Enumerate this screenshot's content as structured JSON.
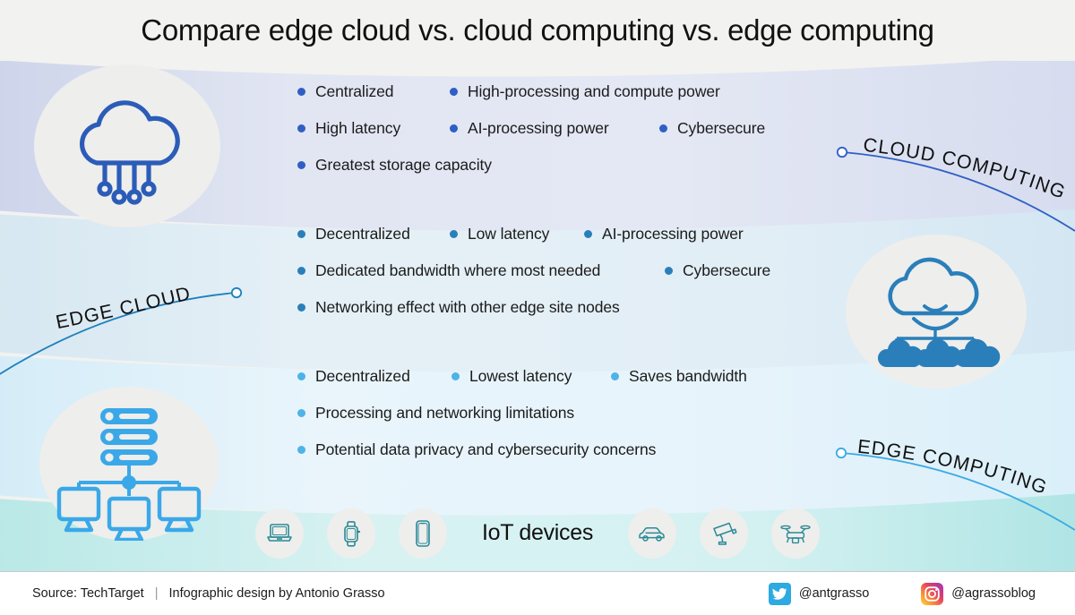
{
  "title": "Compare edge cloud vs. cloud computing vs. edge computing",
  "colors": {
    "cloud_band": "#dfe3f0",
    "edge_cloud_band": "#ddeaf2",
    "edge_computing_band": "#e2f0f8",
    "iot_band": "#cceeee",
    "cloud_bullet": "#2f5fc4",
    "edge_cloud_bullet": "#2a7fba",
    "edge_computing_bullet": "#4db3e8",
    "cloud_icon": "#2b5cb8",
    "edge_cloud_icon": "#2a7fba",
    "edge_computing_icon": "#3aa8e8",
    "badge_fill": "#eeeeec",
    "connector_cloud": "#2f5fc4",
    "connector_edge_cloud": "#1f7fbd",
    "connector_edge_computing": "#3aaae4",
    "twitter": "#2daae1",
    "page_bg": "#f2f2f0"
  },
  "sections": [
    {
      "id": "cloud-computing",
      "label": "CLOUD COMPUTING",
      "icon": "cloud-nodes-icon",
      "rows": [
        [
          "Centralized",
          "High-processing and compute power"
        ],
        [
          "High latency",
          "AI-processing power",
          "Cybersecure"
        ],
        [
          "Greatest storage capacity"
        ]
      ]
    },
    {
      "id": "edge-cloud",
      "label": "EDGE CLOUD",
      "icon": "cloud-hierarchy-icon",
      "rows": [
        [
          "Decentralized",
          "Low latency",
          "AI-processing power"
        ],
        [
          "Dedicated bandwidth where most needed",
          "Cybersecure"
        ],
        [
          "Networking effect with other edge site nodes"
        ]
      ]
    },
    {
      "id": "edge-computing",
      "label": "EDGE COMPUTING",
      "icon": "server-network-icon",
      "rows": [
        [
          "Decentralized",
          "Lowest latency",
          "Saves bandwidth"
        ],
        [
          "Processing and networking limitations"
        ],
        [
          "Potential data privacy and cybersecurity concerns"
        ]
      ]
    }
  ],
  "iot": {
    "label": "IoT devices",
    "left_icons": [
      "laptop-icon",
      "smartwatch-icon",
      "smartphone-icon"
    ],
    "right_icons": [
      "car-icon",
      "security-camera-icon",
      "drone-icon"
    ]
  },
  "footer": {
    "source": "Source: TechTarget",
    "separator": "|",
    "credit": "Infographic design by Antonio Grasso",
    "socials": [
      {
        "icon": "twitter-icon",
        "handle": "@antgrasso"
      },
      {
        "icon": "instagram-icon",
        "handle": "@agrassoblog"
      }
    ]
  }
}
